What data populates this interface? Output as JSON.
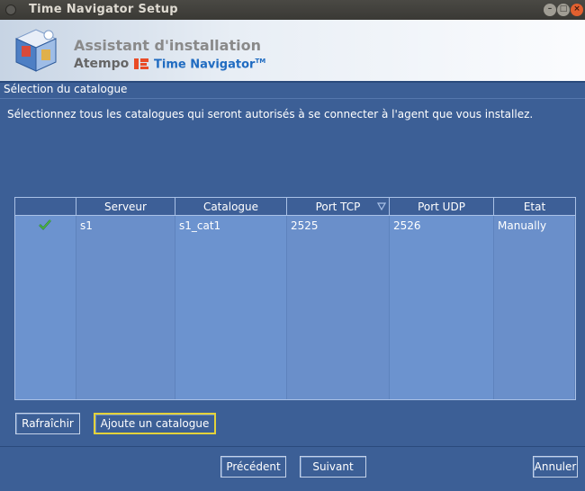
{
  "window": {
    "title": "Time Navigator Setup",
    "controls": {
      "minimize": "–",
      "maximize": "□",
      "close": "×"
    }
  },
  "banner": {
    "heading": "Assistant d'installation",
    "brand": "Atempo",
    "product": "Time Navigator",
    "trademark": "TM"
  },
  "section": {
    "title": "Sélection du catalogue",
    "instruction": "Sélectionnez tous les catalogues qui seront autorisés à se connecter à l'agent que vous installez."
  },
  "table": {
    "columns": [
      "",
      "Serveur",
      "Catalogue",
      "Port TCP",
      "Port UDP",
      "Etat"
    ],
    "sorted_column": "Port TCP",
    "rows": [
      {
        "selected_icon": "check-icon",
        "serveur": "s1",
        "catalogue": "s1_cat1",
        "port_tcp": "2525",
        "port_udp": "2526",
        "etat": "Manually"
      }
    ]
  },
  "actions": {
    "refresh": "Rafraîchir",
    "add_catalog": "Ajoute un catalogue"
  },
  "nav": {
    "previous": "Précédent",
    "next": "Suivant",
    "cancel": "Annuler"
  },
  "colors": {
    "background": "#3c5f96",
    "table_body": "#6c93cf",
    "accent_focus": "#e3d23a"
  }
}
